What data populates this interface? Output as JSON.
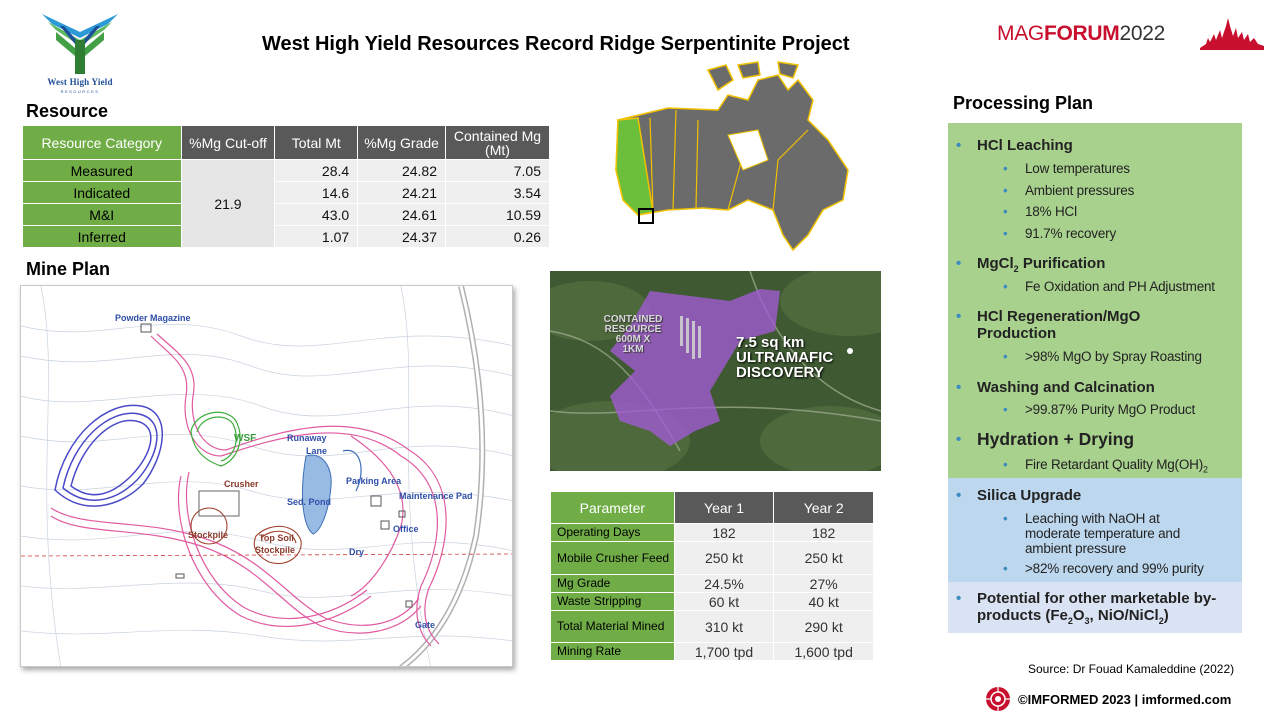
{
  "header": {
    "title": "West High Yield Resources Record Ridge Serpentinite Project",
    "logo_name": "West High Yield",
    "logo_sub": "RESOURCES",
    "magforum": {
      "mag": "MAG",
      "forum": "FORUM",
      "year": "2022"
    }
  },
  "resource": {
    "heading": "Resource",
    "columns": [
      "Resource Category",
      "%Mg Cut-off",
      "Total Mt",
      "%Mg Grade",
      "Contained Mg (Mt)"
    ],
    "cutoff": "21.9",
    "rows": [
      {
        "category": "Measured",
        "total_mt": "28.4",
        "grade": "24.82",
        "contained": "7.05"
      },
      {
        "category": "Indicated",
        "total_mt": "14.6",
        "grade": "24.21",
        "contained": "3.54"
      },
      {
        "category": "M&I",
        "total_mt": "43.0",
        "grade": "24.61",
        "contained": "10.59"
      },
      {
        "category": "Inferred",
        "total_mt": "1.07",
        "grade": "24.37",
        "contained": "0.26"
      }
    ]
  },
  "mine_plan": {
    "heading": "Mine Plan",
    "labels": {
      "powder": "Powder Magazine",
      "wsf": "WSF",
      "runaway": "Runaway",
      "lane": "Lane",
      "crusher": "Crusher",
      "parking": "Parking Area",
      "maintenance": "Maintenance Pad",
      "sed_pond": "Sed. Pond",
      "stockpile": "Stockpile",
      "top_soil": "Top Soil",
      "top_soil_2": "Stockpile",
      "office": "Office",
      "dry": "Dry",
      "gate": "Gate"
    }
  },
  "satellite": {
    "contained": [
      "CONTAINED",
      "RESOURCE",
      "600M X",
      "1KM"
    ],
    "discovery": [
      "7.5 sq km",
      "ULTRAMAFIC",
      "DISCOVERY"
    ]
  },
  "parameters": {
    "columns": [
      "Parameter",
      "Year 1",
      "Year 2"
    ],
    "rows": [
      {
        "name": "Operating Days",
        "y1": "182",
        "y2": "182"
      },
      {
        "name": "Mobile Crusher Feed",
        "y1": "250 kt",
        "y2": "250 kt"
      },
      {
        "name": "Mg Grade",
        "y1": "24.5%",
        "y2": "27%"
      },
      {
        "name": "Waste Stripping",
        "y1": "60 kt",
        "y2": "40 kt"
      },
      {
        "name": "Total Material Mined",
        "y1": "310 kt",
        "y2": "290 kt"
      },
      {
        "name": "Mining Rate",
        "y1": "1,700 tpd",
        "y2": "1,600 tpd"
      }
    ]
  },
  "processing": {
    "heading": "Processing Plan",
    "hcl_leaching": "HCl Leaching",
    "hcl_items": [
      "Low temperatures",
      "Ambient pressures",
      "18% HCl",
      "91.7% recovery"
    ],
    "mgcl_main": "MgCl",
    "mgcl_sub": "2",
    "mgcl_rest": " Purification",
    "mgcl_item": "Fe Oxidation and PH Adjustment",
    "regen_line1": "HCl Regeneration/MgO",
    "regen_line2": "Production",
    "regen_item": ">98% MgO by Spray Roasting",
    "washing": "Washing and Calcination",
    "washing_item": ">99.87% Purity MgO Product",
    "hydration": "Hydration + Drying",
    "hydration_item_main": "Fire Retardant Quality Mg(OH)",
    "hydration_item_sub": "2",
    "silica": "Silica Upgrade",
    "silica_item1": [
      "Leaching with NaOH at",
      "moderate temperature and",
      "ambient pressure"
    ],
    "silica_item2": ">82% recovery and 99% purity",
    "potential_line1": "Potential for other marketable by-",
    "potential_a": "products (Fe",
    "potential_b": "2",
    "potential_c": "O",
    "potential_d": "3",
    "potential_e": ", NiO/NiCl",
    "potential_f": "2",
    "potential_g": ")"
  },
  "source": "Source: Dr Fouad Kamaleddine (2022)",
  "footer": "©IMFORMED 2023  | imformed.com"
}
